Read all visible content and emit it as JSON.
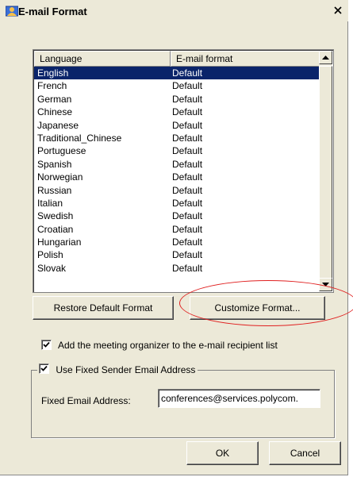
{
  "window": {
    "title": "E-mail Format",
    "close_glyph": "✕"
  },
  "listview": {
    "columns": [
      "Language",
      "E-mail format"
    ],
    "rows": [
      {
        "language": "English",
        "format": "Default"
      },
      {
        "language": "French",
        "format": "Default"
      },
      {
        "language": "German",
        "format": "Default"
      },
      {
        "language": "Chinese",
        "format": "Default"
      },
      {
        "language": "Japanese",
        "format": "Default"
      },
      {
        "language": "Traditional_Chinese",
        "format": "Default"
      },
      {
        "language": "Portuguese",
        "format": "Default"
      },
      {
        "language": "Spanish",
        "format": "Default"
      },
      {
        "language": "Norwegian",
        "format": "Default"
      },
      {
        "language": "Russian",
        "format": "Default"
      },
      {
        "language": "Italian",
        "format": "Default"
      },
      {
        "language": "Swedish",
        "format": "Default"
      },
      {
        "language": "Croatian",
        "format": "Default"
      },
      {
        "language": "Hungarian",
        "format": "Default"
      },
      {
        "language": "Polish",
        "format": "Default"
      },
      {
        "language": "Slovak",
        "format": "Default"
      }
    ],
    "selected_index": 0
  },
  "buttons": {
    "restore": "Restore Default Format",
    "customize": "Customize Format...",
    "ok": "OK",
    "cancel": "Cancel"
  },
  "options": {
    "add_organizer": {
      "label": "Add the meeting organizer to the e-mail recipient list",
      "checked": true
    },
    "fixed_sender": {
      "label": "Use Fixed Sender Email Address",
      "checked": true
    }
  },
  "fixed_email": {
    "label": "Fixed Email Address:",
    "value": "conferences@services.polycom."
  },
  "colors": {
    "selection": "#0A246A",
    "annotation": "#E02020",
    "dialog_bg": "#ECE9D8"
  }
}
